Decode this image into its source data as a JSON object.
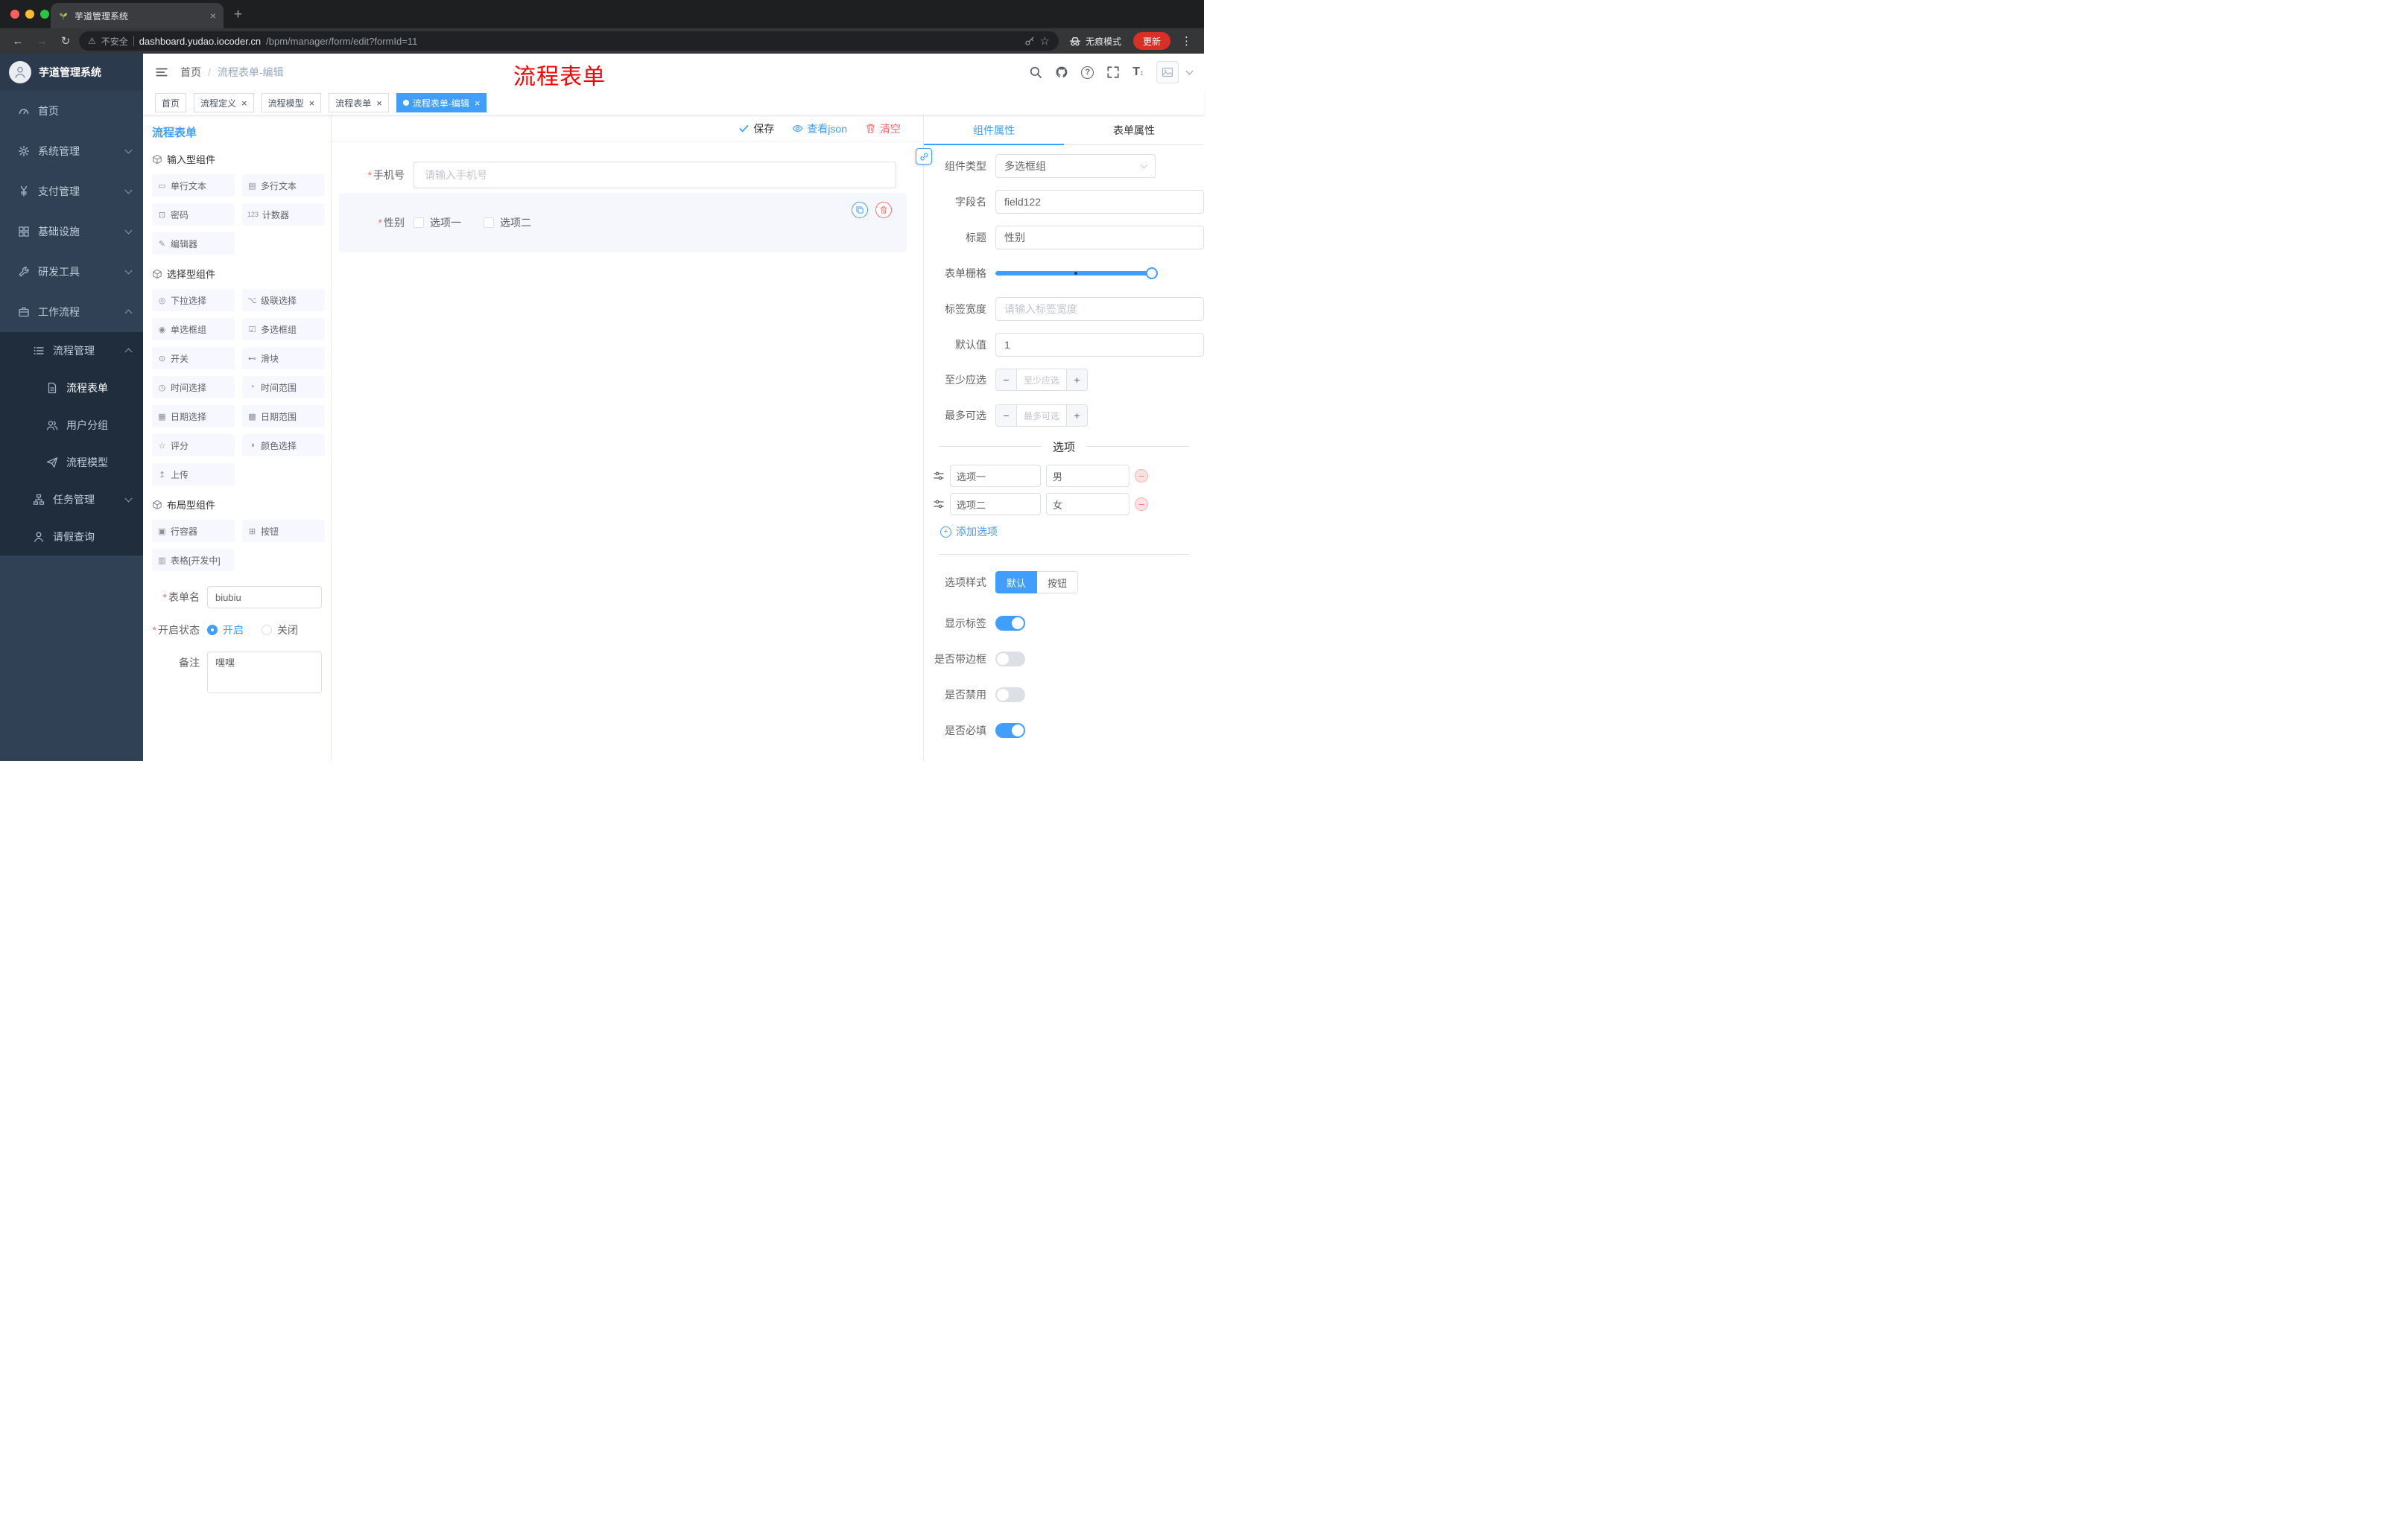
{
  "colors": {
    "accent": "#409eff",
    "danger": "#f56c6c",
    "page_title_red": "#ff0000",
    "sidebar_bg": "#304156",
    "submenu_bg": "#1f2d3d"
  },
  "glyphs": {
    "back": "←",
    "forward": "→",
    "reload": "↻",
    "warning": "⚠",
    "star": "☆",
    "menu_dots": "⋮",
    "new_tab": "+",
    "close": "×",
    "check": "✓",
    "minus": "−",
    "plus": "+",
    "question": "?",
    "font_size": "T"
  },
  "browser": {
    "tab_title": "芋道管理系统",
    "security_label": "不安全",
    "url_host": "dashboard.yudao.iocoder.cn",
    "url_path": "/bpm/manager/form/edit?formId=11",
    "incognito_label": "无痕模式",
    "update_label": "更新"
  },
  "header": {
    "breadcrumb_root": "首页",
    "breadcrumb_sep": "/",
    "breadcrumb_current": "流程表单-编辑",
    "center_title": "流程表单"
  },
  "sidebar": {
    "logo_title": "芋道管理系统",
    "items": [
      {
        "label": "首页",
        "icon": "dashboard-icon"
      },
      {
        "label": "系统管理",
        "icon": "gear-icon",
        "expand": "down"
      },
      {
        "label": "支付管理",
        "icon": "yen-icon",
        "expand": "down"
      },
      {
        "label": "基础设施",
        "icon": "grid-icon",
        "expand": "down"
      },
      {
        "label": "研发工具",
        "icon": "tools-icon",
        "expand": "down"
      },
      {
        "label": "工作流程",
        "icon": "briefcase-icon",
        "expand": "up"
      },
      {
        "label": "流程管理",
        "icon": "list-icon",
        "expand": "up"
      },
      {
        "label": "流程表单",
        "icon": "document-icon"
      },
      {
        "label": "用户分组",
        "icon": "users-icon"
      },
      {
        "label": "流程模型",
        "icon": "send-icon"
      },
      {
        "label": "任务管理",
        "icon": "sitemap-icon",
        "expand": "down"
      },
      {
        "label": "请假查询",
        "icon": "person-icon"
      }
    ]
  },
  "tags": [
    {
      "label": "首页",
      "closable": false,
      "active": false
    },
    {
      "label": "流程定义",
      "closable": true,
      "active": false
    },
    {
      "label": "流程模型",
      "closable": true,
      "active": false
    },
    {
      "label": "流程表单",
      "closable": true,
      "active": false
    },
    {
      "label": "流程表单-编辑",
      "closable": true,
      "active": true
    }
  ],
  "palette": {
    "title": "流程表单",
    "sections": [
      {
        "title": "输入型组件",
        "items": [
          {
            "label": "单行文本",
            "icon": "▭"
          },
          {
            "label": "多行文本",
            "icon": "▤"
          },
          {
            "label": "密码",
            "icon": "⊡"
          },
          {
            "label": "计数器",
            "icon": "123"
          },
          {
            "label": "编辑器",
            "icon": "✎"
          }
        ]
      },
      {
        "title": "选择型组件",
        "items": [
          {
            "label": "下拉选择",
            "icon": "◎"
          },
          {
            "label": "级联选择",
            "icon": "⌥"
          },
          {
            "label": "单选框组",
            "icon": "◉"
          },
          {
            "label": "多选框组",
            "icon": "☑"
          },
          {
            "label": "开关",
            "icon": "⊙"
          },
          {
            "label": "滑块",
            "icon": "⊷"
          },
          {
            "label": "时间选择",
            "icon": "◷"
          },
          {
            "label": "时间范围",
            "icon": "◔"
          },
          {
            "label": "日期选择",
            "icon": "▦"
          },
          {
            "label": "日期范围",
            "icon": "▩"
          },
          {
            "label": "评分",
            "icon": "☆"
          },
          {
            "label": "颜色选择",
            "icon": "◑"
          },
          {
            "label": "上传",
            "icon": "↥"
          }
        ]
      },
      {
        "title": "布局型组件",
        "items": [
          {
            "label": "行容器",
            "icon": "▣"
          },
          {
            "label": "按钮",
            "icon": "⊞"
          },
          {
            "label": "表格[开发中]",
            "icon": "▥"
          }
        ]
      }
    ]
  },
  "palette_form": {
    "name_label": "表单名",
    "name_value": "biubiu",
    "status_label": "开启状态",
    "status_on": "开启",
    "status_off": "关闭",
    "remark_label": "备注",
    "remark_value": "嘿嘿"
  },
  "canvas": {
    "save_label": "保存",
    "view_json_label": "查看json",
    "clear_label": "清空",
    "phone": {
      "label": "手机号",
      "placeholder": "请输入手机号"
    },
    "gender": {
      "label": "性别",
      "option1": "选项一",
      "option2": "选项二"
    }
  },
  "props": {
    "tab_component": "组件属性",
    "tab_form": "表单属性",
    "rows": {
      "type_label": "组件类型",
      "type_value": "多选框组",
      "field_label": "字段名",
      "field_value": "field122",
      "title_label": "标题",
      "title_value": "性别",
      "grid_label": "表单栅格",
      "label_width_label": "标签宽度",
      "label_width_placeholder": "请输入标签宽度",
      "default_label": "默认值",
      "default_value": "1",
      "min_label": "至少应选",
      "min_placeholder": "至少应选",
      "max_label": "最多可选",
      "max_placeholder": "最多可选"
    },
    "options": {
      "divider_title": "选项",
      "rows": [
        {
          "name": "选项一",
          "value": "男"
        },
        {
          "name": "选项二",
          "value": "女"
        }
      ],
      "add_label": "添加选项"
    },
    "style": {
      "label": "选项样式",
      "opt_default": "默认",
      "opt_button": "按钮"
    },
    "switches": [
      {
        "label": "显示标签",
        "on": true
      },
      {
        "label": "是否带边框",
        "on": false
      },
      {
        "label": "是否禁用",
        "on": false
      },
      {
        "label": "是否必填",
        "on": true
      }
    ]
  }
}
